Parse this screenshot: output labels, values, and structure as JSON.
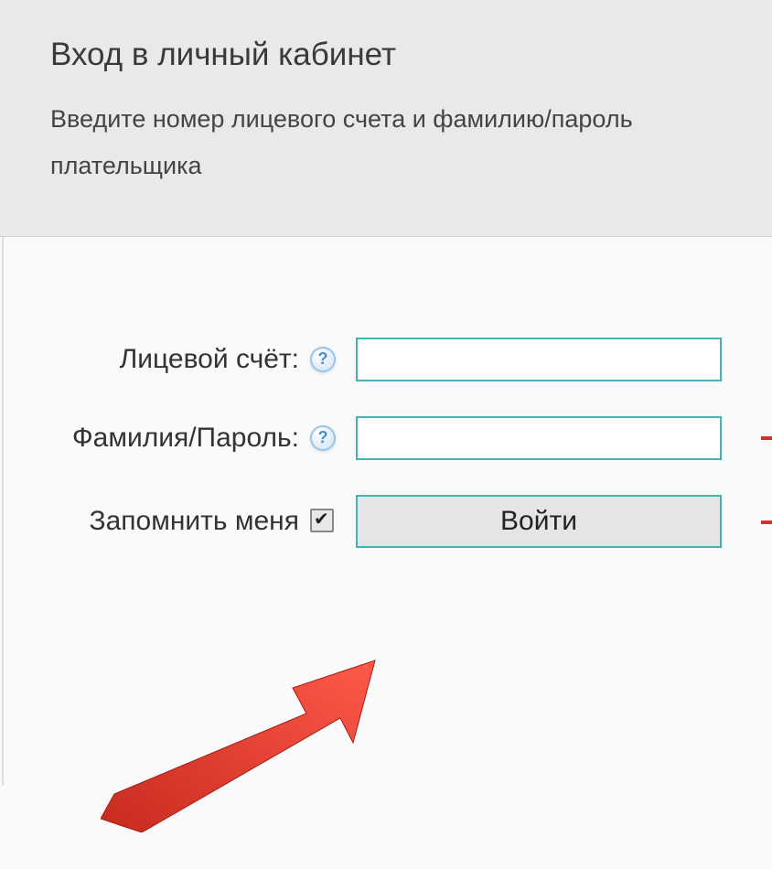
{
  "header": {
    "title": "Вход в личный кабинет",
    "subtitle": "Введите номер лицевого счета и фамилию/пароль плательщика"
  },
  "form": {
    "account_label": "Лицевой счёт:",
    "password_label": "Фамилия/Пароль:",
    "remember_label": "Запомнить меня",
    "login_button": "Войти",
    "account_value": "",
    "password_value": "",
    "help_icon_text": "?",
    "remember_checked": true
  },
  "colors": {
    "accent": "#3fb5b5",
    "arrow": "#e43a2e"
  }
}
